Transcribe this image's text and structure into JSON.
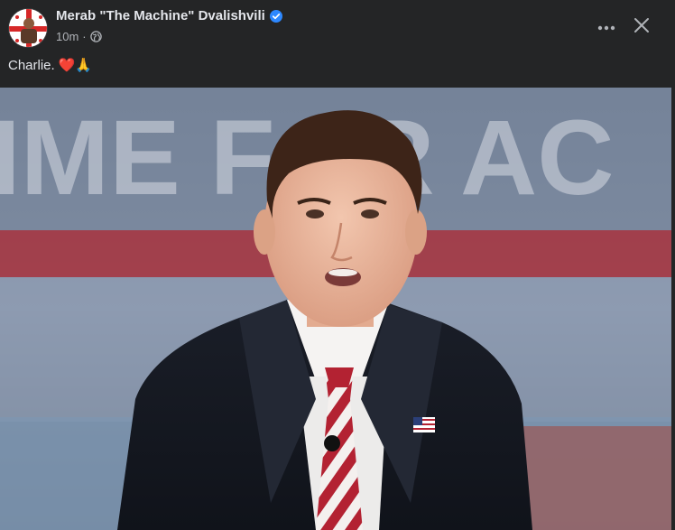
{
  "post": {
    "author_name": "Merab \"The Machine\" Dvalishvili",
    "time_ago": "10m",
    "separator": "·",
    "privacy_icon": "globe-icon",
    "verified_icon": "verified-badge-icon",
    "caption_text": "Charlie.",
    "caption_emoji": "❤️🙏",
    "more_icon": "more-options-icon",
    "close_icon": "close-icon",
    "photo": {
      "description_icon": "photo",
      "background_sign_text": "IME FOR AC"
    }
  },
  "colors": {
    "background": "#242526",
    "text_primary": "#e4e6eb",
    "text_secondary": "#b0b3b8",
    "verified_blue": "#2d88ff"
  }
}
